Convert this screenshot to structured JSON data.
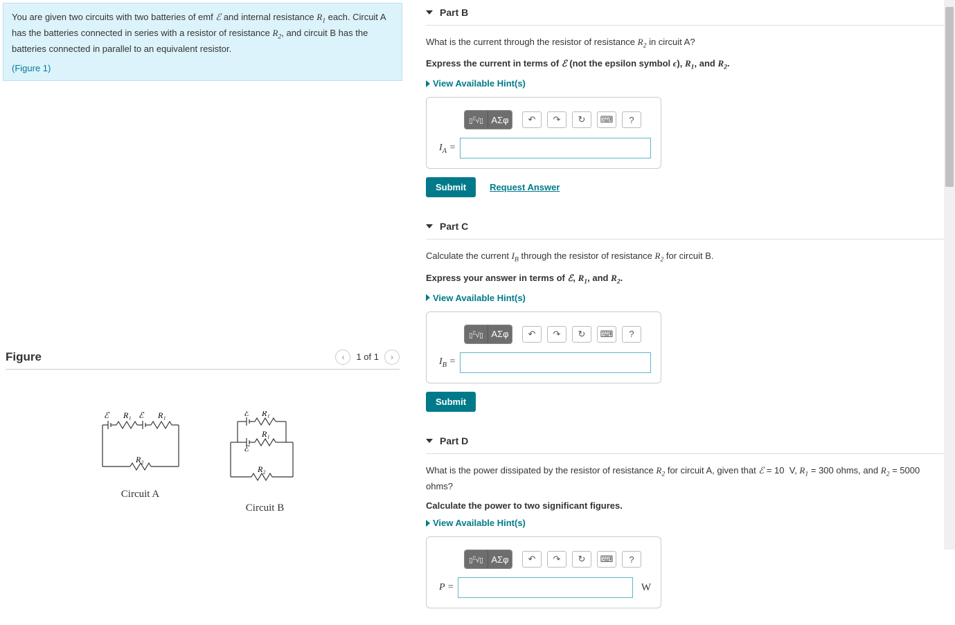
{
  "problem": {
    "text_html": "You are given two circuits with two batteries of emf <span class='math'>ℰ</span> and internal resistance <span class='math'>R<span class='sub'>1</span></span> each. Circuit A has the batteries connected in series with a resistor of resistance <span class='math'>R<span class='sub'>2</span></span>, and circuit B has the batteries connected in parallel to an equivalent resistor.",
    "figure_link": "(Figure 1)"
  },
  "figure": {
    "title": "Figure",
    "pager": "1 of 1",
    "circuit_a": "Circuit A",
    "circuit_b": "Circuit B"
  },
  "parts": {
    "b": {
      "title": "Part B",
      "q_html": "What is the current through the resistor of resistance <span class='math'>R<span class='sub'>2</span></span> in circuit A?",
      "instr_html": "Express the current in terms of <span class='math'>ℰ</span> (not the epsilon symbol <span class='math'>ϵ</span>), <span class='math'>R<span class='sub'>1</span></span>, and <span class='math'>R<span class='sub'>2</span></span>.",
      "hints": "View Available Hint(s)",
      "label_html": "<span class='math'>I<span class='sub'>A</span></span> =",
      "submit": "Submit",
      "request": "Request Answer"
    },
    "c": {
      "title": "Part C",
      "q_html": "Calculate the current <span class='math'>I<span class='sub'>B</span></span> through the resistor of resistance <span class='math'>R<span class='sub'>2</span></span> for circuit B.",
      "instr_html": "Express your answer in terms of <span class='math'>ℰ</span>, <span class='math'>R<span class='sub'>1</span></span>, and <span class='math'>R<span class='sub'>2</span></span>.",
      "hints": "View Available Hint(s)",
      "label_html": "<span class='math'>I<span class='sub'>B</span></span> =",
      "submit": "Submit"
    },
    "d": {
      "title": "Part D",
      "q_html": "What is the power dissipated by the resistor of resistance <span class='math'>R<span class='sub'>2</span></span> for circuit A, given that <span class='math'>ℰ</span> = 10&nbsp;&nbsp;V, <span class='math'>R<span class='sub'>1</span></span> = 300 ohms, and <span class='math'>R<span class='sub'>2</span></span> = 5000 ohms?",
      "instr_html": "Calculate the power to two significant figures.",
      "hints": "View Available Hint(s)",
      "label_html": "<span class='math'>P</span> =",
      "unit": "W"
    }
  },
  "toolbar": {
    "templates": "▫√▫",
    "greek": "ΑΣφ",
    "undo": "↶",
    "redo": "↷",
    "reset": "↻",
    "keyboard": "⌨",
    "help": "?"
  }
}
